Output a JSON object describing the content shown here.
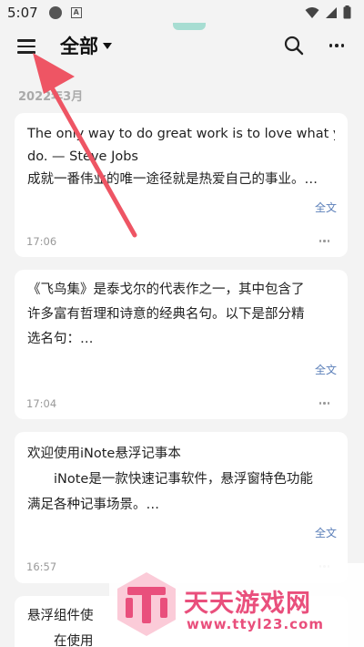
{
  "status_bar": {
    "time": "5:07"
  },
  "app_bar": {
    "title": "全部"
  },
  "section": {
    "label": "2022年3月"
  },
  "notes": [
    {
      "lines": [
        "The only way to do great work is to love what you",
        "do. — Steve Jobs",
        "成就一番伟业的唯一途径就是热爱自己的事业。…"
      ],
      "full_label": "全文",
      "time": "17:06"
    },
    {
      "lines": [
        "《飞鸟集》是泰戈尔的代表作之一，其中包含了",
        "许多富有哲理和诗意的经典名句。以下是部分精",
        "选名句：…"
      ],
      "full_label": "全文",
      "time": "17:04"
    },
    {
      "lines": [
        "欢迎使用iNote悬浮记事本",
        "iNote是一款快速记事软件，悬浮窗特色功能",
        "满足各种记事场景。…"
      ],
      "full_label": "全文",
      "time": "16:57"
    },
    {
      "lines": [
        "悬浮组件使",
        "在使用"
      ]
    }
  ],
  "watermark": {
    "title": "天天游戏网",
    "url": "www.ttyl23.com"
  },
  "colors": {
    "accent": "#5b7fb9",
    "arrow": "#ee5564",
    "watermark": "#e94f7c",
    "pill": "#a7ddd2"
  }
}
